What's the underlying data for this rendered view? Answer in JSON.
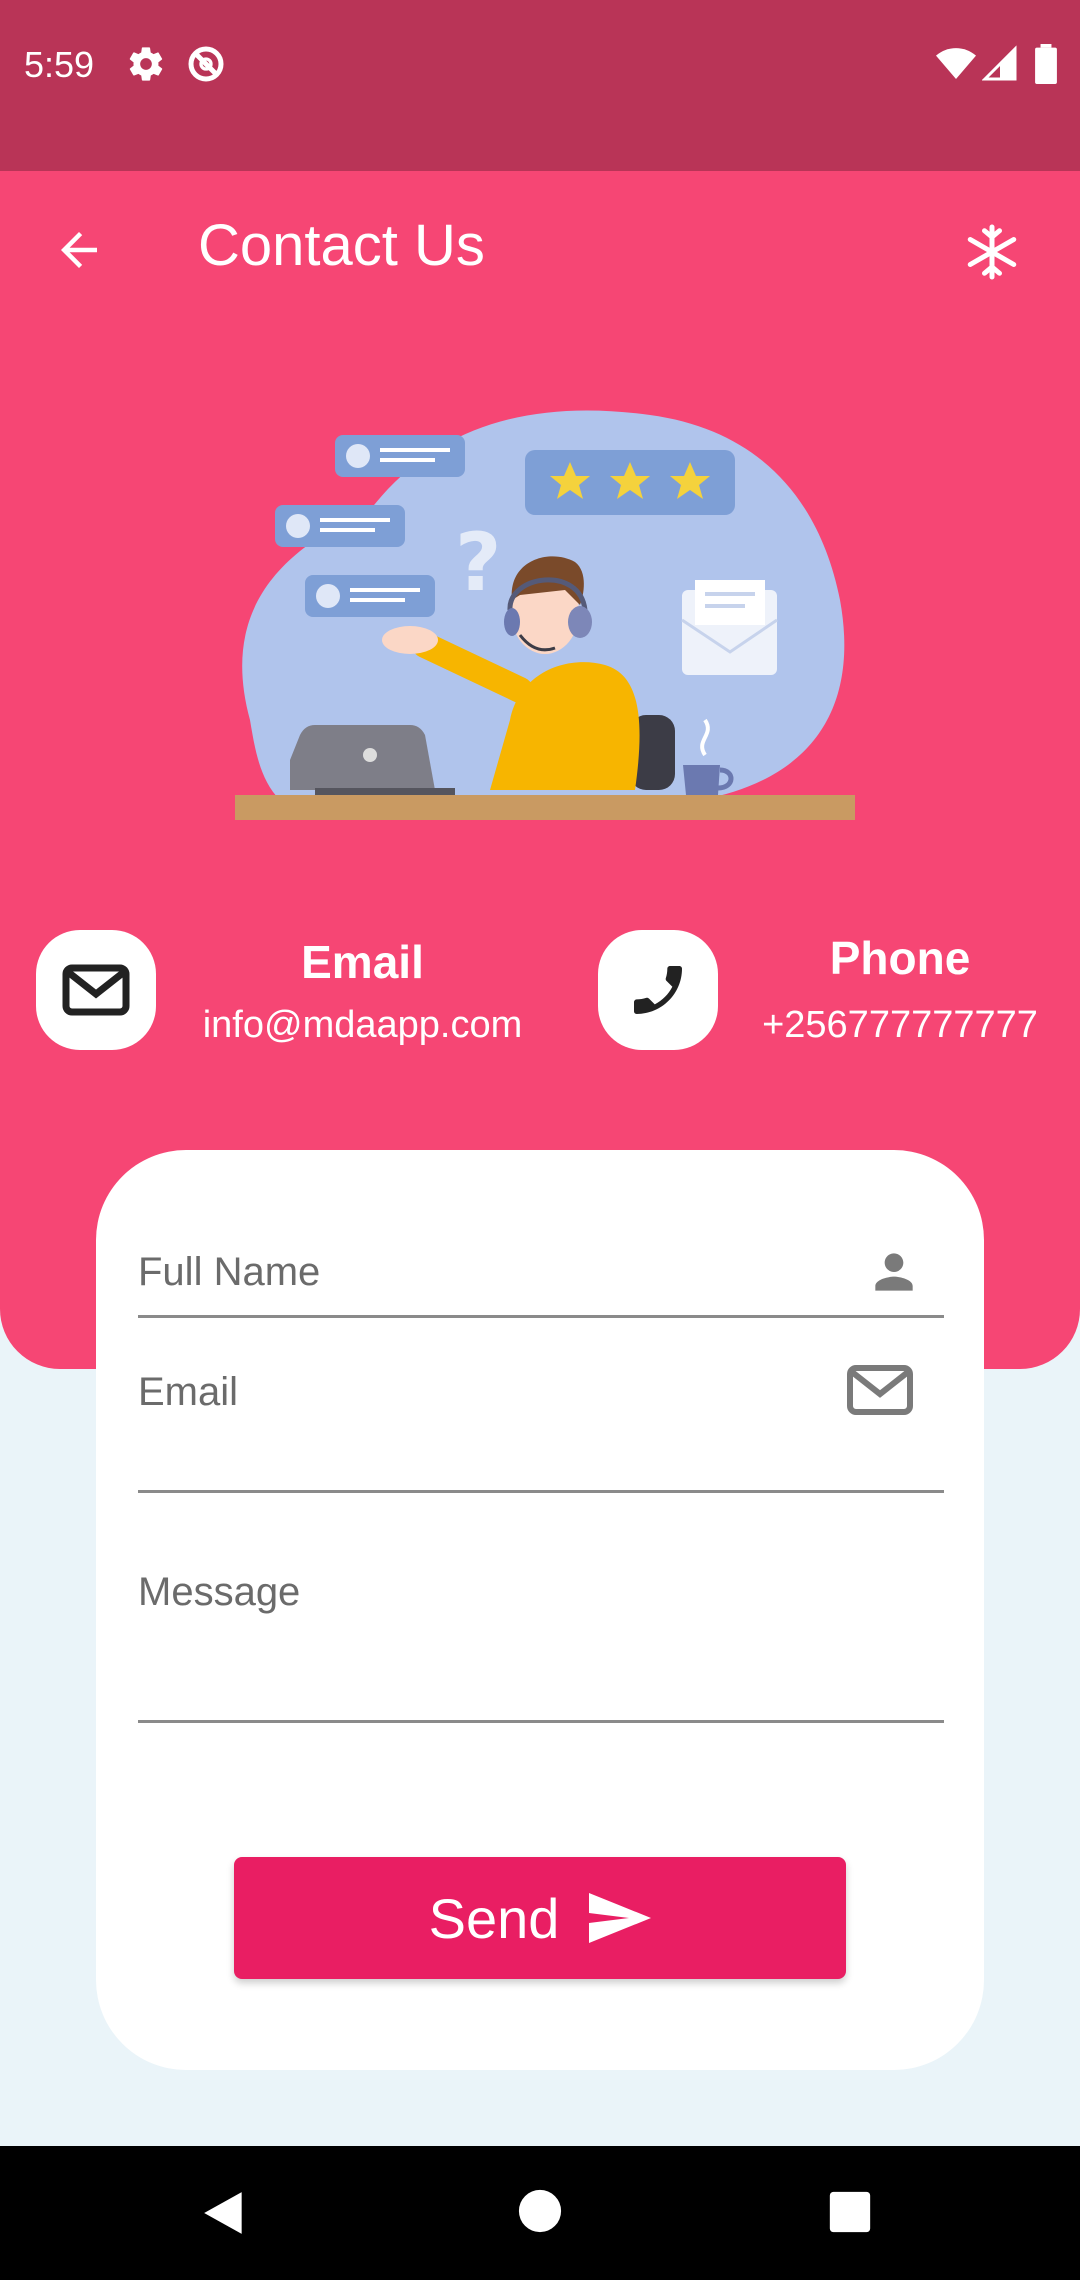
{
  "status_bar": {
    "time": "5:59",
    "icons": [
      "gear-icon",
      "no-disturb-icon",
      "wifi-icon",
      "signal-icon",
      "battery-icon"
    ]
  },
  "header": {
    "title": "Contact Us",
    "back_icon": "arrow-left-icon",
    "action_icon": "snowflake-icon",
    "background_color": "#f64674"
  },
  "contacts": {
    "email": {
      "label": "Email",
      "value": "info@mdaapp.com",
      "icon": "envelope-icon"
    },
    "phone": {
      "label": "Phone",
      "value": "+256777777777",
      "icon": "phone-icon"
    }
  },
  "form": {
    "full_name": {
      "label": "Full Name",
      "icon": "person-icon"
    },
    "email": {
      "label": "Email",
      "icon": "envelope-icon"
    },
    "message": {
      "label": "Message"
    },
    "send_label": "Send",
    "send_color": "#e91e63"
  },
  "nav_bar": {
    "icons": [
      "back-triangle-icon",
      "home-circle-icon",
      "recents-square-icon"
    ]
  }
}
